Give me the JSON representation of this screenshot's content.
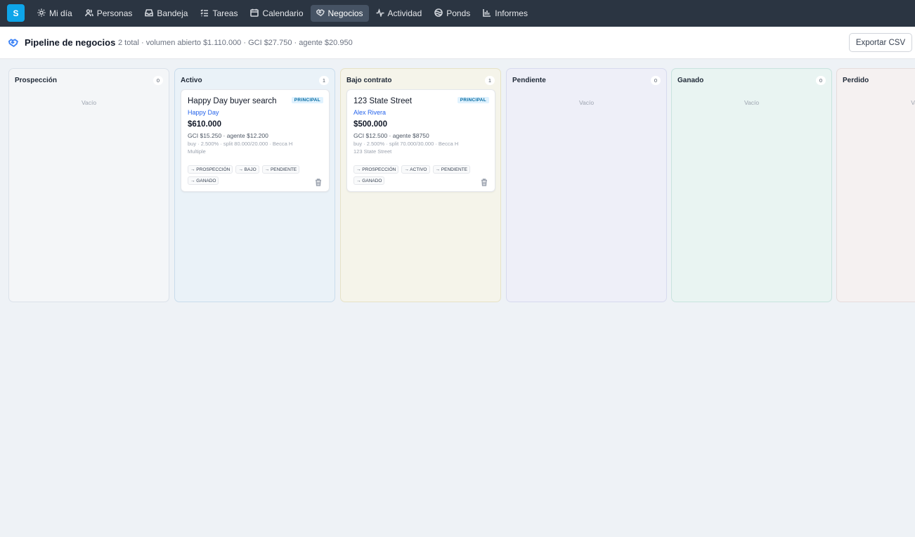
{
  "nav": {
    "logo": "S",
    "items": [
      {
        "label": "Mi día",
        "icon": "sun-icon"
      },
      {
        "label": "Personas",
        "icon": "users-icon"
      },
      {
        "label": "Bandeja",
        "icon": "inbox-icon"
      },
      {
        "label": "Tareas",
        "icon": "list-check-icon"
      },
      {
        "label": "Calendario",
        "icon": "calendar-icon"
      },
      {
        "label": "Negocios",
        "icon": "handshake-icon",
        "active": true
      },
      {
        "label": "Actividad",
        "icon": "activity-icon"
      },
      {
        "label": "Ponds",
        "icon": "pond-icon"
      },
      {
        "label": "Informes",
        "icon": "bar-chart-icon"
      }
    ]
  },
  "header": {
    "title": "Pipeline de negocios",
    "summary": "2 total · volumen abierto $1.110.000 · GCI $27.750 · agente $20.950",
    "export_label": "Exportar CSV"
  },
  "columns": [
    {
      "title": "Prospección",
      "count": "0",
      "empty": "Vacío",
      "bg": "#f4f6f8",
      "border": "#dbe2ea"
    },
    {
      "title": "Activo",
      "count": "1",
      "empty": "",
      "bg": "#eaf2f8",
      "border": "#c9dcec"
    },
    {
      "title": "Bajo contrato",
      "count": "1",
      "empty": "",
      "bg": "#f5f4ea",
      "border": "#e6e2c6"
    },
    {
      "title": "Pendiente",
      "count": "0",
      "empty": "Vacío",
      "bg": "#eeeff8",
      "border": "#d7daee"
    },
    {
      "title": "Ganado",
      "count": "0",
      "empty": "Vacío",
      "bg": "#e9f4f2",
      "border": "#c8e3de"
    },
    {
      "title": "Perdido",
      "count": "",
      "empty": "Va",
      "bg": "#f5f1f1",
      "border": "#e6dcdc"
    }
  ],
  "cards": [
    {
      "title": "Happy Day buyer search",
      "badge": "PRINCIPAL",
      "contact": "Happy Day",
      "price": "$610.000",
      "gci": "GCI $15.250 · agente $12.200",
      "meta": "buy · 2.500% · split 80.000/20.000 · Becca H",
      "meta2": "Multiple",
      "actions": [
        "→ PROSPECCIÓN",
        "→ BAJO",
        "→ PENDIENTE",
        "→ GANADO"
      ]
    },
    {
      "title": "123 State Street",
      "badge": "PRINCIPAL",
      "contact": "Alex Rivera",
      "price": "$500.000",
      "gci": "GCI $12.500 · agente $8750",
      "meta": "buy · 2.500% · split 70.000/30.000 · Becca H",
      "meta2": "123 State Street",
      "actions": [
        "→ PROSPECCIÓN",
        "→ ACTIVO",
        "→ PENDIENTE",
        "→ GANADO"
      ]
    }
  ],
  "colors": {
    "nav_bg": "#2b3542",
    "accent": "#0ea5e9",
    "link": "#2563eb"
  }
}
